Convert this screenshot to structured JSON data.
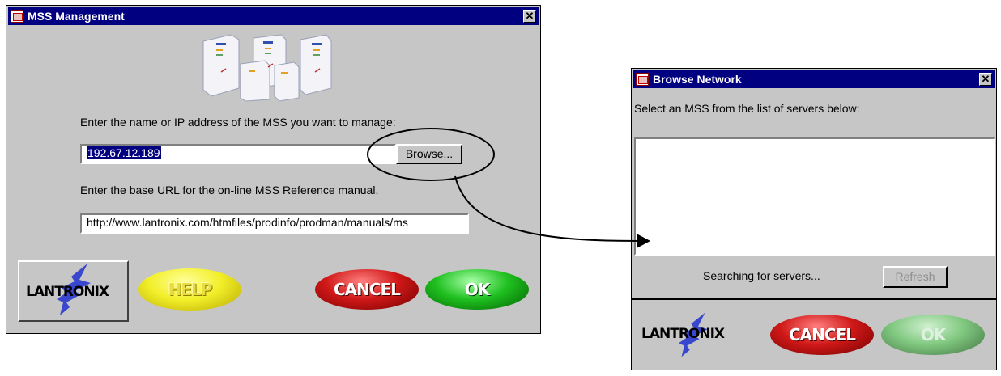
{
  "mss_window": {
    "title": "MSS Management",
    "close_glyph": "✕",
    "prompt_name": "Enter the name or IP address of the MSS you want to manage:",
    "ip_value": "192.67.12.189",
    "browse_label": "Browse...",
    "prompt_url": "Enter the base URL for the on-line MSS Reference manual.",
    "url_value": "http://www.lantronix.com/htmfiles/prodinfo/prodman/manuals/ms",
    "logo_text": "LANTRONIX",
    "help_label": "HELP",
    "cancel_label": "CANCEL",
    "ok_label": "OK"
  },
  "browse_window": {
    "title": "Browse Network",
    "close_glyph": "✕",
    "instruction": "Select an MSS from the list of servers below:",
    "status_text": "Searching for servers...",
    "refresh_label": "Refresh",
    "logo_text": "LANTRONIX",
    "cancel_label": "CANCEL",
    "ok_label": "OK"
  },
  "colors": {
    "title_bar": "#000080",
    "window_face": "#c6c6c6",
    "help_button": "#f2ef2a",
    "cancel_button": "#d01818",
    "ok_button": "#20c020"
  },
  "icons": [
    "mss-devices-image",
    "lantronix-logo",
    "window-app-icon",
    "close-icon",
    "annotation-ellipse",
    "annotation-arrow"
  ]
}
